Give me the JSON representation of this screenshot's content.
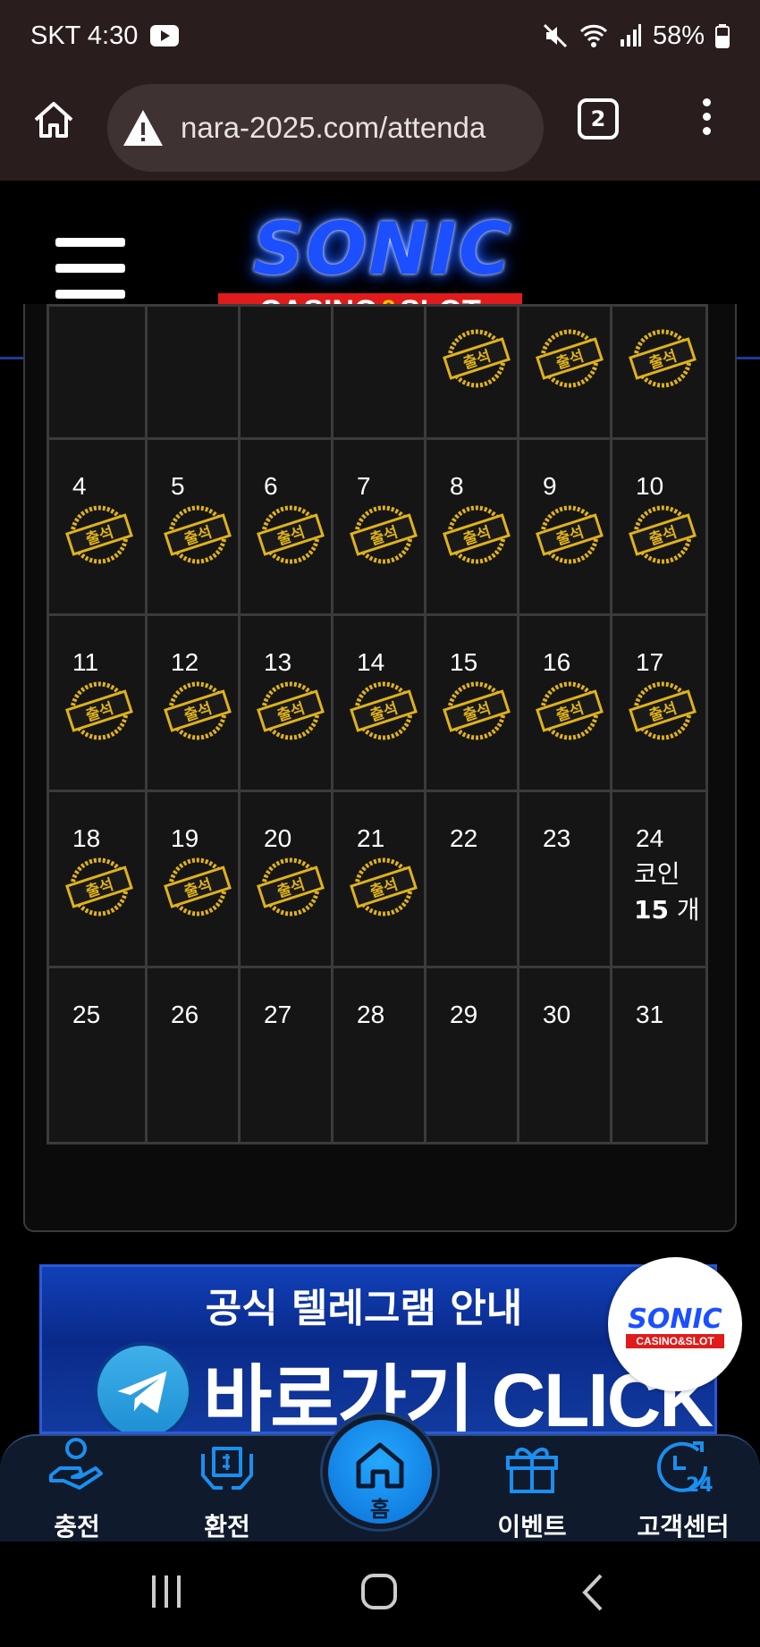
{
  "status_bar": {
    "carrier_time": "SKT 4:30",
    "battery": "58%",
    "icons": [
      "youtube-icon",
      "mute-icon",
      "wifi-icon",
      "signal-icon",
      "battery-icon"
    ]
  },
  "browser": {
    "url": "nara-2025.com/attenda",
    "tab_count": "2",
    "icons": [
      "home-icon",
      "warning-icon",
      "tabs-icon",
      "more-icon"
    ]
  },
  "header": {
    "logo_text": "SONIC",
    "logo_sub_left": "CASINO",
    "logo_sub_amp": "&",
    "logo_sub_right": "SLOT"
  },
  "calendar": {
    "stamp_label": "출석",
    "coin_label": "코인",
    "coin_amount": "15",
    "coin_unit": "개",
    "rows": [
      [
        {
          "day": "",
          "stamped": false
        },
        {
          "day": "",
          "stamped": false
        },
        {
          "day": "",
          "stamped": false
        },
        {
          "day": "",
          "stamped": false
        },
        {
          "day": "",
          "stamped": true
        },
        {
          "day": "",
          "stamped": true
        },
        {
          "day": "",
          "stamped": true
        }
      ],
      [
        {
          "day": "4",
          "stamped": true
        },
        {
          "day": "5",
          "stamped": true
        },
        {
          "day": "6",
          "stamped": true
        },
        {
          "day": "7",
          "stamped": true
        },
        {
          "day": "8",
          "stamped": true
        },
        {
          "day": "9",
          "stamped": true
        },
        {
          "day": "10",
          "stamped": true
        }
      ],
      [
        {
          "day": "11",
          "stamped": true
        },
        {
          "day": "12",
          "stamped": true
        },
        {
          "day": "13",
          "stamped": true
        },
        {
          "day": "14",
          "stamped": true
        },
        {
          "day": "15",
          "stamped": true
        },
        {
          "day": "16",
          "stamped": true
        },
        {
          "day": "17",
          "stamped": true
        }
      ],
      [
        {
          "day": "18",
          "stamped": true
        },
        {
          "day": "19",
          "stamped": true
        },
        {
          "day": "20",
          "stamped": true
        },
        {
          "day": "21",
          "stamped": true
        },
        {
          "day": "22",
          "stamped": false
        },
        {
          "day": "23",
          "stamped": false
        },
        {
          "day": "24",
          "stamped": false,
          "coin": true
        }
      ],
      [
        {
          "day": "25",
          "stamped": false
        },
        {
          "day": "26",
          "stamped": false
        },
        {
          "day": "27",
          "stamped": false
        },
        {
          "day": "28",
          "stamped": false
        },
        {
          "day": "29",
          "stamped": false
        },
        {
          "day": "30",
          "stamped": false
        },
        {
          "day": "31",
          "stamped": false
        }
      ]
    ]
  },
  "banner": {
    "title": "공식 텔레그램 안내",
    "cta": "바로가기 CLICK"
  },
  "float_logo": {
    "brand": "SONIC",
    "sub": "CASINO&SLOT"
  },
  "bottom_nav": {
    "deposit": "충전",
    "withdraw": "환전",
    "home": "홈",
    "event": "이벤트",
    "support": "고객센터"
  },
  "colors": {
    "accent_blue": "#1b8ff0",
    "stamp_gold": "#e0b21a",
    "logo_red": "#e11b1b"
  }
}
